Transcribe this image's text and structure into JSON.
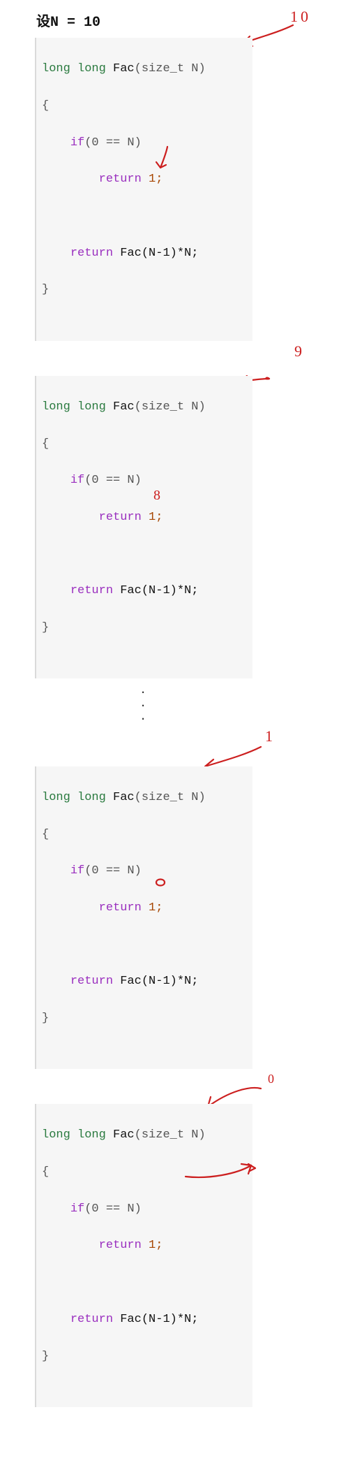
{
  "heading_prefix": "设",
  "heading_expr": "N = 10",
  "code": {
    "sig_pre": "long long",
    "fn": "Fac",
    "sig_post": "(size_t N)",
    "open_brace": "{",
    "if_kw": "if",
    "if_cond": "(0 == N)",
    "ret_kw": "return",
    "ret1_val": " 1;",
    "ret2_expr_pre": " Fac(N-1)*N;",
    "ret2_expr_first_inner": " Fac(N",
    "ret2_minus1_styled": "-1",
    "ret2_tail": ")*N;",
    "close_brace": "}"
  },
  "annotations": {
    "block1_in": "10",
    "block2_in": "9",
    "block2_out": "8",
    "block3_in": "1",
    "block3_out": "0",
    "block4_in": "0"
  },
  "ellipsis": "."
}
